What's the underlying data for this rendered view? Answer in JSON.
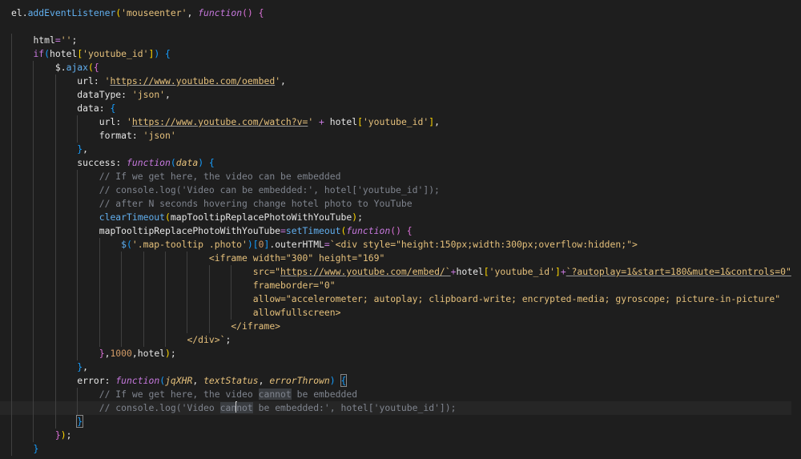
{
  "colors": {
    "background": "#1e1e1e",
    "current_line": "#262626",
    "keyword": "#c678dd",
    "function": "#61afef",
    "string": "#e5c07b",
    "number": "#d19a66",
    "comment": "#7f848e",
    "bracket_gold": "#ffd700",
    "bracket_orchid": "#da70d6",
    "bracket_blue": "#179fff"
  },
  "cursor": {
    "line": 31,
    "column": 24
  },
  "lines": [
    {
      "indent": 0,
      "tokens": [
        {
          "t": "el",
          "c": "txt"
        },
        {
          "t": ".",
          "c": "txt"
        },
        {
          "t": "addEventListener",
          "c": "fn"
        },
        {
          "t": "(",
          "c": "br1"
        },
        {
          "t": "'mouseenter'",
          "c": "str"
        },
        {
          "t": ", ",
          "c": "txt"
        },
        {
          "t": "function",
          "c": "kwi"
        },
        {
          "t": "() ",
          "c": "br2"
        },
        {
          "t": "{",
          "c": "br2"
        }
      ]
    },
    {
      "indent": 0,
      "tokens": []
    },
    {
      "indent": 1,
      "tokens": [
        {
          "t": "html",
          "c": "txt"
        },
        {
          "t": "=",
          "c": "op"
        },
        {
          "t": "''",
          "c": "str"
        },
        {
          "t": ";",
          "c": "txt"
        }
      ]
    },
    {
      "indent": 1,
      "tokens": [
        {
          "t": "if",
          "c": "kw"
        },
        {
          "t": "(",
          "c": "br3"
        },
        {
          "t": "hotel",
          "c": "txt"
        },
        {
          "t": "[",
          "c": "br1"
        },
        {
          "t": "'youtube_id'",
          "c": "str"
        },
        {
          "t": "]",
          "c": "br1"
        },
        {
          "t": ") ",
          "c": "br3"
        },
        {
          "t": "{",
          "c": "br3"
        }
      ]
    },
    {
      "indent": 2,
      "tokens": [
        {
          "t": "$",
          "c": "txt"
        },
        {
          "t": ".",
          "c": "txt"
        },
        {
          "t": "ajax",
          "c": "fn"
        },
        {
          "t": "(",
          "c": "br1"
        },
        {
          "t": "{",
          "c": "br2"
        }
      ]
    },
    {
      "indent": 3,
      "tokens": [
        {
          "t": "url",
          "c": "prop"
        },
        {
          "t": ": ",
          "c": "txt"
        },
        {
          "t": "'",
          "c": "str"
        },
        {
          "t": "https://www.youtube.com/oembed",
          "c": "strul"
        },
        {
          "t": "'",
          "c": "str"
        },
        {
          "t": ",",
          "c": "txt"
        }
      ]
    },
    {
      "indent": 3,
      "tokens": [
        {
          "t": "dataType",
          "c": "prop"
        },
        {
          "t": ": ",
          "c": "txt"
        },
        {
          "t": "'json'",
          "c": "str"
        },
        {
          "t": ",",
          "c": "txt"
        }
      ]
    },
    {
      "indent": 3,
      "tokens": [
        {
          "t": "data",
          "c": "prop"
        },
        {
          "t": ": ",
          "c": "txt"
        },
        {
          "t": "{",
          "c": "br3"
        }
      ]
    },
    {
      "indent": 4,
      "tokens": [
        {
          "t": "url",
          "c": "prop"
        },
        {
          "t": ": ",
          "c": "txt"
        },
        {
          "t": "'",
          "c": "str"
        },
        {
          "t": "https://www.youtube.com/watch?v=",
          "c": "strul"
        },
        {
          "t": "'",
          "c": "str"
        },
        {
          "t": " + ",
          "c": "op"
        },
        {
          "t": "hotel",
          "c": "txt"
        },
        {
          "t": "[",
          "c": "br1"
        },
        {
          "t": "'youtube_id'",
          "c": "str"
        },
        {
          "t": "]",
          "c": "br1"
        },
        {
          "t": ",",
          "c": "txt"
        }
      ]
    },
    {
      "indent": 4,
      "tokens": [
        {
          "t": "format",
          "c": "prop"
        },
        {
          "t": ": ",
          "c": "txt"
        },
        {
          "t": "'json'",
          "c": "str"
        }
      ]
    },
    {
      "indent": 3,
      "tokens": [
        {
          "t": "}",
          "c": "br3"
        },
        {
          "t": ",",
          "c": "txt"
        }
      ]
    },
    {
      "indent": 3,
      "tokens": [
        {
          "t": "success",
          "c": "prop"
        },
        {
          "t": ": ",
          "c": "txt"
        },
        {
          "t": "function",
          "c": "kwi"
        },
        {
          "t": "(",
          "c": "br3"
        },
        {
          "t": "data",
          "c": "prm"
        },
        {
          "t": ") ",
          "c": "br3"
        },
        {
          "t": "{",
          "c": "br3"
        }
      ]
    },
    {
      "indent": 4,
      "tokens": [
        {
          "t": "// If we get here, the video can be embedded",
          "c": "cm"
        }
      ]
    },
    {
      "indent": 4,
      "tokens": [
        {
          "t": "// console.log('Video can be embedded:', hotel['youtube_id']);",
          "c": "cm"
        }
      ]
    },
    {
      "indent": 4,
      "tokens": [
        {
          "t": "// after N seconds hovering change hotel photo to YouTube",
          "c": "cm"
        }
      ]
    },
    {
      "indent": 4,
      "tokens": [
        {
          "t": "clearTimeout",
          "c": "fn"
        },
        {
          "t": "(",
          "c": "br1"
        },
        {
          "t": "mapTooltipReplacePhotoWithYouTube",
          "c": "txt"
        },
        {
          "t": ")",
          "c": "br1"
        },
        {
          "t": ";",
          "c": "txt"
        }
      ]
    },
    {
      "indent": 4,
      "tokens": [
        {
          "t": "mapTooltipReplacePhotoWithYouTube",
          "c": "txt"
        },
        {
          "t": "=",
          "c": "op"
        },
        {
          "t": "setTimeout",
          "c": "fn"
        },
        {
          "t": "(",
          "c": "br1"
        },
        {
          "t": "function",
          "c": "kwi"
        },
        {
          "t": "() ",
          "c": "br2"
        },
        {
          "t": "{",
          "c": "br2"
        }
      ]
    },
    {
      "indent": 5,
      "tokens": [
        {
          "t": "$",
          "c": "fn"
        },
        {
          "t": "(",
          "c": "br3"
        },
        {
          "t": "'.map-tooltip .photo'",
          "c": "str"
        },
        {
          "t": ")",
          "c": "br3"
        },
        {
          "t": "[",
          "c": "br3"
        },
        {
          "t": "0",
          "c": "num"
        },
        {
          "t": "]",
          "c": "br3"
        },
        {
          "t": ".",
          "c": "txt"
        },
        {
          "t": "outerHTML",
          "c": "txt"
        },
        {
          "t": "=",
          "c": "op"
        },
        {
          "t": "`<div style=\"height:150px;width:300px;overflow:hidden;\">",
          "c": "str"
        }
      ]
    },
    {
      "indent": 9,
      "tokens": [
        {
          "t": "<iframe width=\"300\" height=\"169\"",
          "c": "str"
        }
      ]
    },
    {
      "indent": 11,
      "tokens": [
        {
          "t": "src=\"",
          "c": "str"
        },
        {
          "t": "https://www.youtube.com/embed/`",
          "c": "strul"
        },
        {
          "t": "+",
          "c": "op"
        },
        {
          "t": "hotel",
          "c": "txt"
        },
        {
          "t": "[",
          "c": "br1"
        },
        {
          "t": "'youtube_id'",
          "c": "str"
        },
        {
          "t": "]",
          "c": "br1"
        },
        {
          "t": "+",
          "c": "op"
        },
        {
          "t": "`?autoplay=1&start=180&mute=1&controls=0\"",
          "c": "strul"
        }
      ]
    },
    {
      "indent": 11,
      "tokens": [
        {
          "t": "frameborder=\"0\"",
          "c": "str"
        }
      ]
    },
    {
      "indent": 11,
      "tokens": [
        {
          "t": "allow=\"accelerometer; autoplay; clipboard-write; encrypted-media; gyroscope; picture-in-picture\"",
          "c": "str"
        }
      ]
    },
    {
      "indent": 11,
      "tokens": [
        {
          "t": "allowfullscreen>",
          "c": "str"
        }
      ]
    },
    {
      "indent": 10,
      "tokens": [
        {
          "t": "</iframe>",
          "c": "str"
        }
      ]
    },
    {
      "indent": 8,
      "tokens": [
        {
          "t": "</div>`",
          "c": "str"
        },
        {
          "t": ";",
          "c": "txt"
        }
      ]
    },
    {
      "indent": 4,
      "tokens": [
        {
          "t": "}",
          "c": "br2"
        },
        {
          "t": ",",
          "c": "txt"
        },
        {
          "t": "1000",
          "c": "num"
        },
        {
          "t": ",",
          "c": "txt"
        },
        {
          "t": "hotel",
          "c": "txt"
        },
        {
          "t": ")",
          "c": "br1"
        },
        {
          "t": ";",
          "c": "txt"
        }
      ]
    },
    {
      "indent": 3,
      "tokens": [
        {
          "t": "}",
          "c": "br3"
        },
        {
          "t": ",",
          "c": "txt"
        }
      ]
    },
    {
      "indent": 3,
      "tokens": [
        {
          "t": "error",
          "c": "prop"
        },
        {
          "t": ": ",
          "c": "txt"
        },
        {
          "t": "function",
          "c": "kwi"
        },
        {
          "t": "(",
          "c": "br3"
        },
        {
          "t": "jqXHR",
          "c": "prm"
        },
        {
          "t": ", ",
          "c": "txt"
        },
        {
          "t": "textStatus",
          "c": "prm"
        },
        {
          "t": ", ",
          "c": "txt"
        },
        {
          "t": "errorThrown",
          "c": "prm"
        },
        {
          "t": ") ",
          "c": "br3"
        },
        {
          "t": "{",
          "c": "br3 brbox"
        }
      ]
    },
    {
      "indent": 4,
      "tokens": [
        {
          "t": "// If we get here, the video ",
          "c": "cm"
        },
        {
          "t": "cannot",
          "c": "cm hl"
        },
        {
          "t": " be embedded",
          "c": "cm"
        }
      ]
    },
    {
      "indent": 4,
      "current": true,
      "tokens": [
        {
          "t": "// console.log('Video ",
          "c": "cm"
        },
        {
          "t": "can",
          "c": "cm hl"
        },
        {
          "t": "",
          "c": "caret"
        },
        {
          "t": "not",
          "c": "cm hl"
        },
        {
          "t": " be embedded:', hotel['youtube_id']);",
          "c": "cm"
        }
      ]
    },
    {
      "indent": 3,
      "tokens": [
        {
          "t": "}",
          "c": "br3 brbox"
        }
      ]
    },
    {
      "indent": 2,
      "tokens": [
        {
          "t": "}",
          "c": "br2"
        },
        {
          "t": ")",
          "c": "br1"
        },
        {
          "t": ";",
          "c": "txt"
        }
      ]
    },
    {
      "indent": 1,
      "tokens": [
        {
          "t": "}",
          "c": "br3"
        }
      ]
    }
  ]
}
